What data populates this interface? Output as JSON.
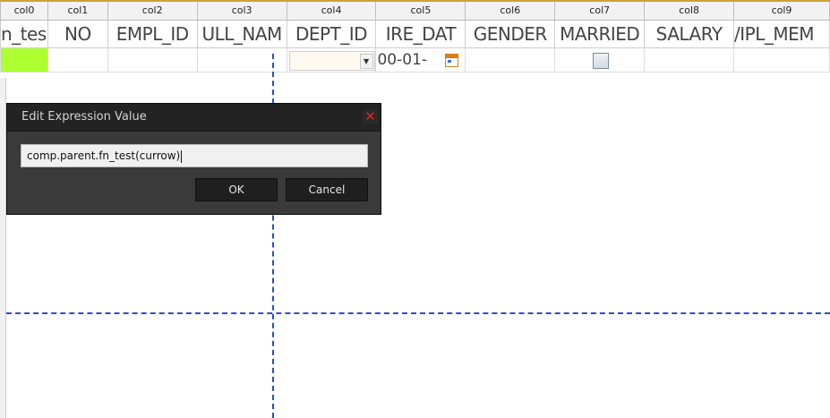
{
  "grid": {
    "header": [
      "col0",
      "col1",
      "col2",
      "col3",
      "col4",
      "col5",
      "col6",
      "col7",
      "col8",
      "col9"
    ],
    "subheader": [
      "n_tes",
      "NO",
      "EMPL_ID",
      "ULL_NAM",
      "DEPT_ID",
      "IRE_DAT",
      "GENDER",
      "MARRIED",
      "SALARY",
      "/IPL_MEM"
    ],
    "row": {
      "date_text": "00-01-",
      "highlight_color": "#adff2f"
    }
  },
  "dialog": {
    "title": "Edit Expression Value",
    "close_glyph": "✕",
    "expression": "comp.parent.fn_test(currow)",
    "ok_label": "OK",
    "cancel_label": "Cancel"
  },
  "icons": {
    "combo_arrow": "▼"
  }
}
